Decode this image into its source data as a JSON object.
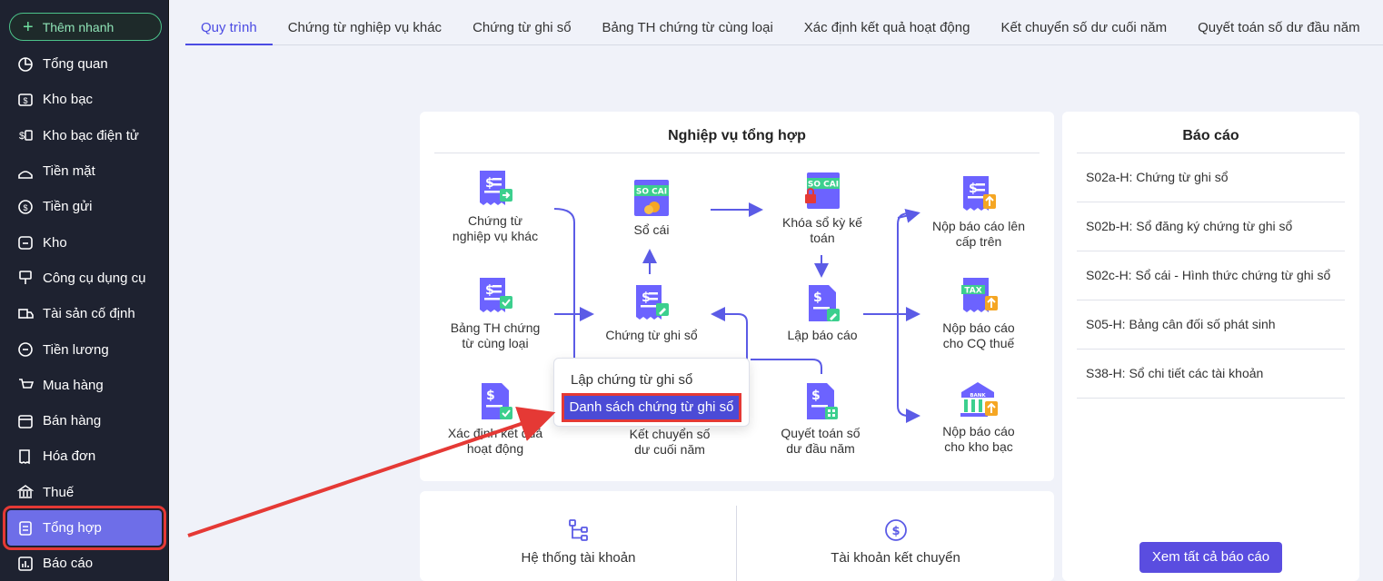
{
  "sidebar": {
    "quick_add": "Thêm nhanh",
    "items": [
      {
        "label": "Tổng quan",
        "icon": "dashboard-icon"
      },
      {
        "label": "Kho bạc",
        "icon": "treasury-icon"
      },
      {
        "label": "Kho bạc điện tử",
        "icon": "e-treasury-icon"
      },
      {
        "label": "Tiền mặt",
        "icon": "cash-icon"
      },
      {
        "label": "Tiền gửi",
        "icon": "deposit-icon"
      },
      {
        "label": "Kho",
        "icon": "warehouse-icon"
      },
      {
        "label": "Công cụ dụng cụ",
        "icon": "tools-icon"
      },
      {
        "label": "Tài sản cố định",
        "icon": "truck-icon"
      },
      {
        "label": "Tiền lương",
        "icon": "salary-icon"
      },
      {
        "label": "Mua hàng",
        "icon": "cart-icon"
      },
      {
        "label": "Bán hàng",
        "icon": "store-icon"
      },
      {
        "label": "Hóa đơn",
        "icon": "invoice-icon"
      },
      {
        "label": "Thuế",
        "icon": "bank-icon"
      },
      {
        "label": "Tổng hợp",
        "icon": "summary-icon"
      },
      {
        "label": "Báo cáo",
        "icon": "report-icon"
      }
    ],
    "active_index": 13
  },
  "tabs": [
    "Quy trình",
    "Chứng từ nghiệp vụ khác",
    "Chứng từ ghi sổ",
    "Bảng TH chứng từ cùng loại",
    "Xác định kết quả hoạt động",
    "Kết chuyển số dư cuối năm",
    "Quyết toán số dư đầu năm"
  ],
  "process": {
    "title": "Nghiệp vụ tổng hợp",
    "nodes": {
      "ctnvk": "Chứng từ\nnghiệp vụ khác",
      "bangth": "Bảng TH chứng\ntừ cùng loại",
      "xdkq": "Xác định kết quả\nhoạt động",
      "socai": "Sổ cái",
      "ctgs": "Chứng từ ghi sổ",
      "ketchuyen": "Kết chuyển số\ndư cuối năm",
      "khoaso": "Khóa sổ kỳ kế\ntoán",
      "lapbaocao": "Lập báo cáo",
      "quyettoan": "Quyết toán số\ndư đầu năm",
      "noplen": "Nộp báo cáo lên\ncấp trên",
      "nopthue": "Nộp báo cáo\ncho CQ thuế",
      "nopkhobac": "Nộp báo cáo\ncho kho bạc"
    },
    "icon_labels": {
      "socai": "SO CAI",
      "tax": "TAX",
      "bank": "BANK"
    }
  },
  "dropdown": {
    "item1": "Lập chứng từ ghi sổ",
    "item2": "Danh sách chứng từ ghi sổ"
  },
  "reports": {
    "title": "Báo cáo",
    "items": [
      "S02a-H: Chứng từ ghi sổ",
      "S02b-H: Sổ đăng ký chứng từ ghi sổ",
      "S02c-H: Sổ cái - Hình thức chứng từ ghi sổ",
      "S05-H: Bảng cân đối số phát sinh",
      "S38-H: Sổ chi tiết các tài khoản"
    ],
    "button": "Xem tất cả báo cáo"
  },
  "bottom": {
    "accounts": "Hệ thống tài khoản",
    "transfer_accounts": "Tài khoản kết chuyển"
  },
  "colors": {
    "accent": "#4b4be3",
    "sidebar_bg": "#1e2230",
    "highlight": "#e53935",
    "icon_purple": "#6c63ff"
  }
}
